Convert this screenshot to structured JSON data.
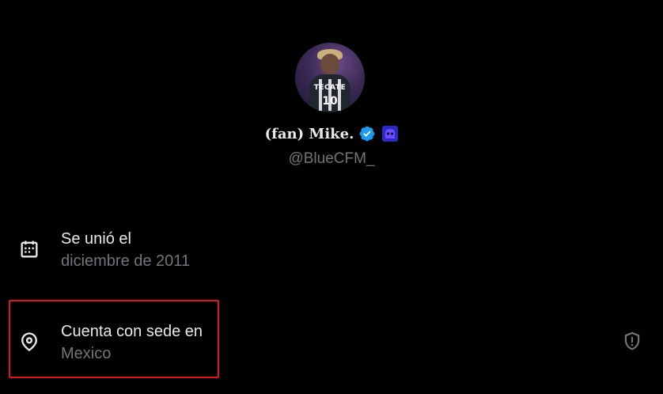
{
  "profile": {
    "display_name": "(fan) Mike.",
    "handle": "@BlueCFM_",
    "avatar_jersey_brand": "TECATE",
    "avatar_jersey_number": "10"
  },
  "joined": {
    "label": "Se unió el",
    "value": "diciembre de 2011",
    "icon": "calendar-icon"
  },
  "location": {
    "label": "Cuenta con sede en",
    "value": "Mexico",
    "icon": "location-pin-icon"
  },
  "icons": {
    "verified": "verified-badge-icon",
    "emoji": "purple-creature-emoji-icon",
    "shield": "shield-alert-icon"
  },
  "colors": {
    "background": "#000000",
    "primary_text": "#e7e9ea",
    "secondary_text": "#71767b",
    "verified_blue": "#1d9bf0",
    "highlight_red": "#e0151b"
  }
}
